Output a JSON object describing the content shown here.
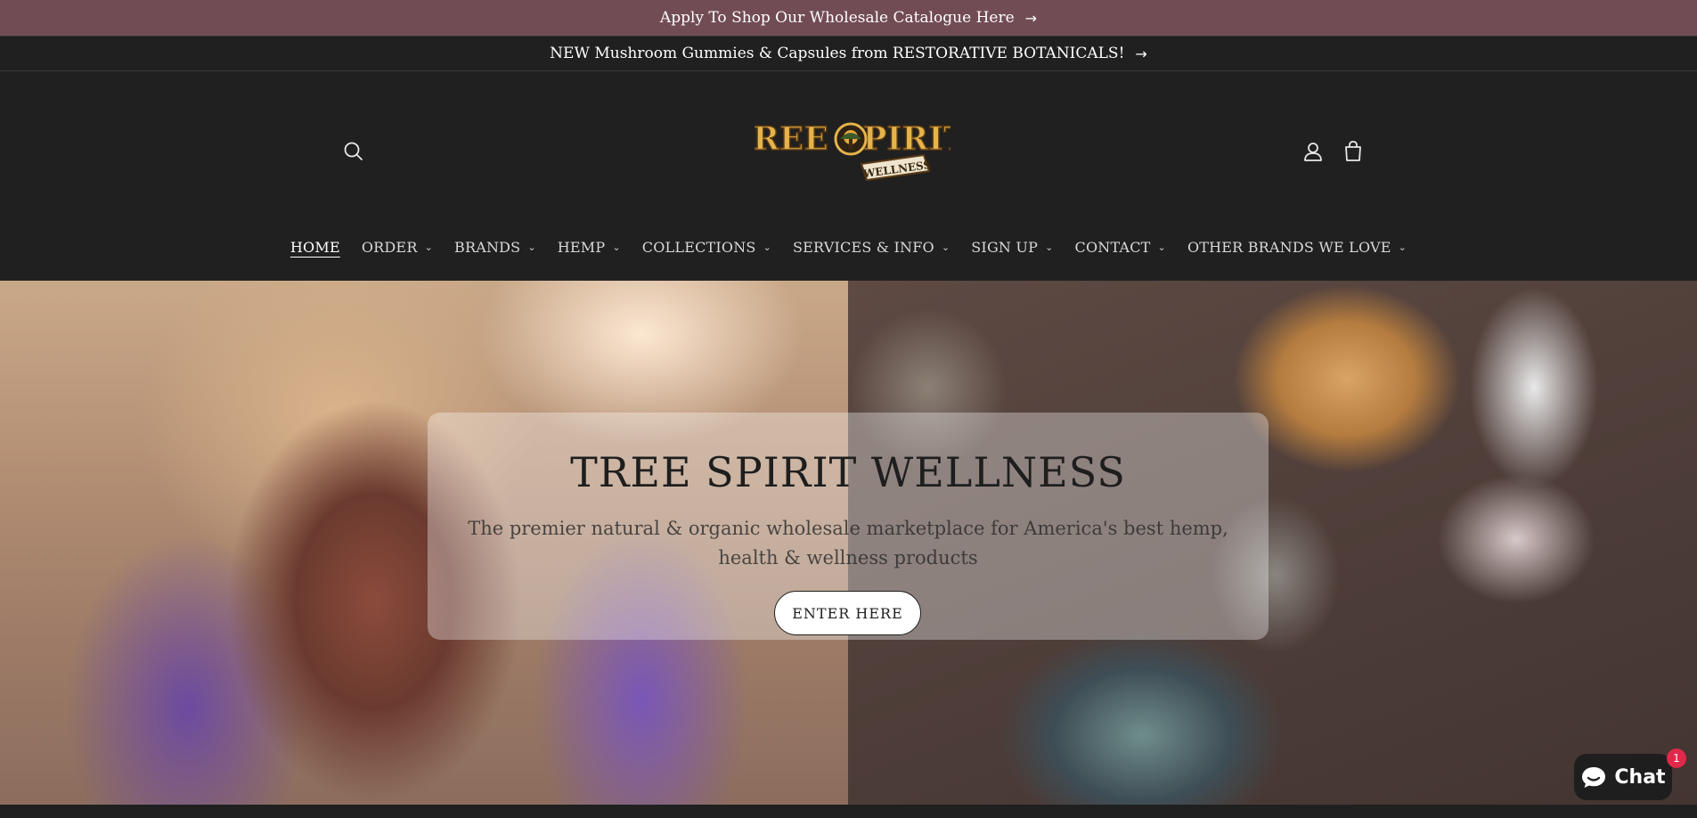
{
  "announcements": [
    {
      "text": "Apply To Shop Our Wholesale Catalogue Here",
      "icon": "arrow-right-icon"
    },
    {
      "text": "NEW Mushroom Gummies & Capsules from RESTORATIVE BOTANICALS!",
      "icon": "arrow-right-icon"
    }
  ],
  "header": {
    "logo_text": "TREE SPIRIT",
    "logo_subtext": "WELLNESS",
    "icons": [
      "search-icon",
      "account-icon",
      "cart-icon"
    ]
  },
  "nav": {
    "items": [
      {
        "label": "HOME",
        "active": true
      },
      {
        "label": "ORDER"
      },
      {
        "label": "BRANDS"
      },
      {
        "label": "HEMP"
      },
      {
        "label": "COLLECTIONS"
      },
      {
        "label": "SERVICES & INFO"
      },
      {
        "label": "SIGN UP"
      },
      {
        "label": "CONTACT"
      },
      {
        "label": "OTHER BRANDS WE LOVE"
      }
    ]
  },
  "hero": {
    "title": "TREE SPIRIT WELLNESS",
    "subtitle": "The premier natural & organic wholesale marketplace for America's best hemp, health & wellness products",
    "button_label": "ENTER HERE"
  },
  "chat": {
    "label": "Chat",
    "badge": "1"
  },
  "colors": {
    "announcement_bg": "#724c55",
    "header_bg": "#202020",
    "chat_badge": "#e0284a"
  }
}
